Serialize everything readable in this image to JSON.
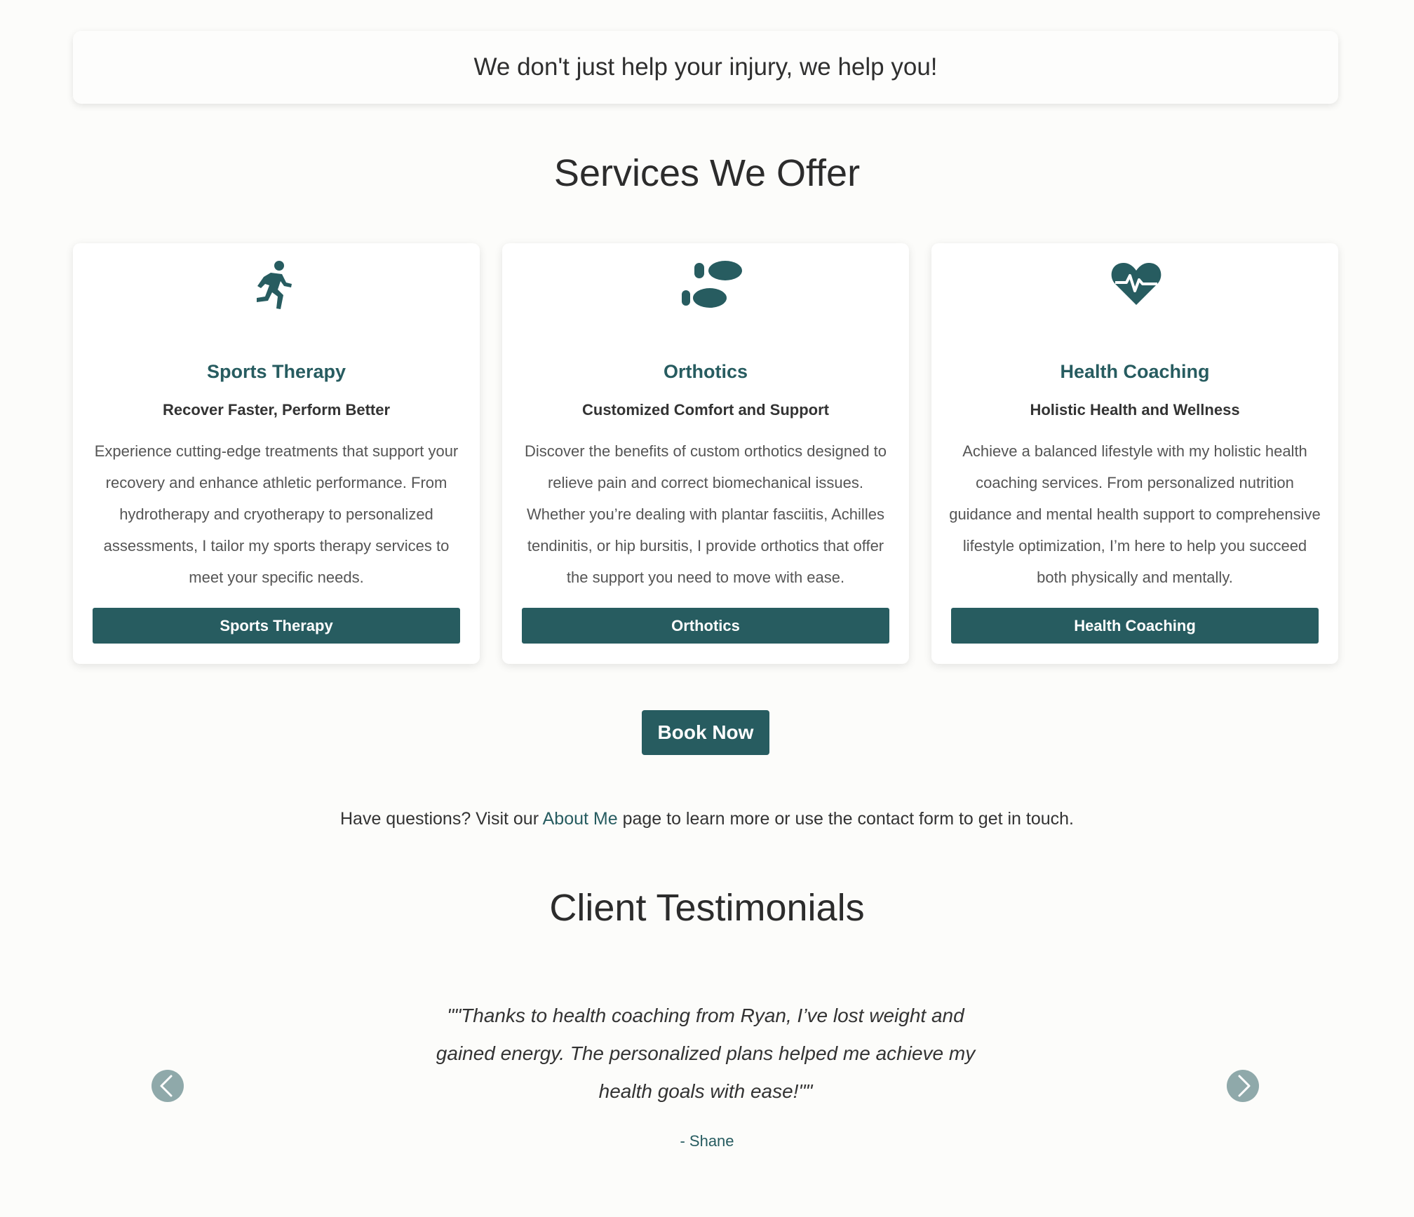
{
  "tagline": "We don't just help your injury, we help you!",
  "services": {
    "title": "Services We Offer",
    "cards": [
      {
        "icon": "running-person-icon",
        "title": "Sports Therapy",
        "subtitle": "Recover Faster, Perform Better",
        "description": "Experience cutting-edge treatments that support your recovery and enhance athletic performance. From hydrotherapy and cryotherapy to personalized assessments, I tailor my sports therapy services to meet your specific needs.",
        "button_label": "Sports Therapy"
      },
      {
        "icon": "shoe-prints-icon",
        "title": "Orthotics",
        "subtitle": "Customized Comfort and Support",
        "description": "Discover the benefits of custom orthotics designed to relieve pain and correct biomechanical issues. Whether you’re dealing with plantar fasciitis, Achilles tendinitis, or hip bursitis, I provide orthotics that offer the support you need to move with ease.",
        "button_label": "Orthotics"
      },
      {
        "icon": "heart-pulse-icon",
        "title": "Health Coaching",
        "subtitle": "Holistic Health and Wellness",
        "description": "Achieve a balanced lifestyle with my holistic health coaching services. From personalized nutrition guidance and mental health support to comprehensive lifestyle optimization, I’m here to help you succeed both physically and mentally.",
        "button_label": "Health Coaching"
      }
    ]
  },
  "book_button_label": "Book Now",
  "questions": {
    "before": "Have questions? Visit our ",
    "link_text": "About Me",
    "after": " page to learn more or use the contact form to get in touch."
  },
  "testimonials": {
    "title": "Client Testimonials",
    "quote": "\"\"Thanks to health coaching from Ryan, I’ve lost weight and gained energy. The personalized plans helped me achieve my health goals with ease!\"\"",
    "author": "- Shane",
    "prev_icon": "chevron-left-icon",
    "next_icon": "chevron-right-icon"
  },
  "colors": {
    "accent": "#275c60",
    "background": "#fcfcfa",
    "arrow": "#8fa9aa"
  }
}
